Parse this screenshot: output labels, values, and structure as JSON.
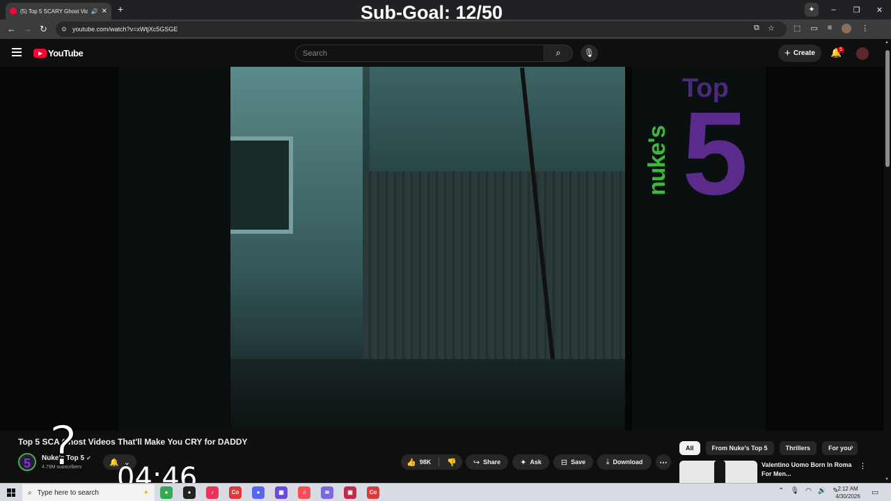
{
  "overlay": {
    "subgoal": "Sub-Goal: 12/50",
    "question_mark": "?",
    "timer": "04:46"
  },
  "browser": {
    "tab_title": "(5) Top 5 SCARY Ghost Vide",
    "new_tab": "+",
    "url": "youtube.com/watch?v=xWtjXc5GSGE",
    "window_controls": {
      "minimize": "–",
      "restore": "❐",
      "close": "✕"
    }
  },
  "youtube": {
    "logo_text": "YouTube",
    "search_placeholder": "Search",
    "create_label": "Create",
    "notification_count": "5"
  },
  "video": {
    "logo_brand": "nuke's",
    "logo_top": "Top",
    "logo_number": "5",
    "title": "Top 5 SCA    Ghost Videos That'll Make You CRY for DADDY",
    "channel": {
      "name": "Nuke's Top 5",
      "subscribers": "4.79M subscribers",
      "avatar_glyph": "5"
    },
    "actions": {
      "likes": "98K",
      "share": "Share",
      "ask": "Ask",
      "save": "Save",
      "download": "Download"
    }
  },
  "sidebar": {
    "chips": [
      "All",
      "From Nuke's Top 5",
      "Thrillers",
      "For you"
    ],
    "recommendation": {
      "title": "Valentino Uomo Born In Roma For Men..."
    }
  },
  "taskbar": {
    "search_placeholder": "Type here to search",
    "apps": [
      {
        "name": "chrome",
        "glyph": "●",
        "color": "#34a853"
      },
      {
        "name": "capcut",
        "glyph": "●",
        "color": "#222222"
      },
      {
        "name": "tiktok",
        "glyph": "♪",
        "color": "#e8335a"
      },
      {
        "name": "app-co-1",
        "glyph": "Co",
        "color": "#d93a3a"
      },
      {
        "name": "discord",
        "glyph": "●",
        "color": "#5865f2"
      },
      {
        "name": "grid-app",
        "glyph": "▦",
        "color": "#6a4ad8"
      },
      {
        "name": "music",
        "glyph": "♫",
        "color": "#f94c57"
      },
      {
        "name": "wave-app",
        "glyph": "≋",
        "color": "#7a6adf"
      },
      {
        "name": "image-app",
        "glyph": "▣",
        "color": "#c22a4a"
      },
      {
        "name": "app-co-2",
        "glyph": "Co",
        "color": "#d93a3a"
      }
    ],
    "time": "2:12 AM",
    "date": "4/30/2026"
  }
}
